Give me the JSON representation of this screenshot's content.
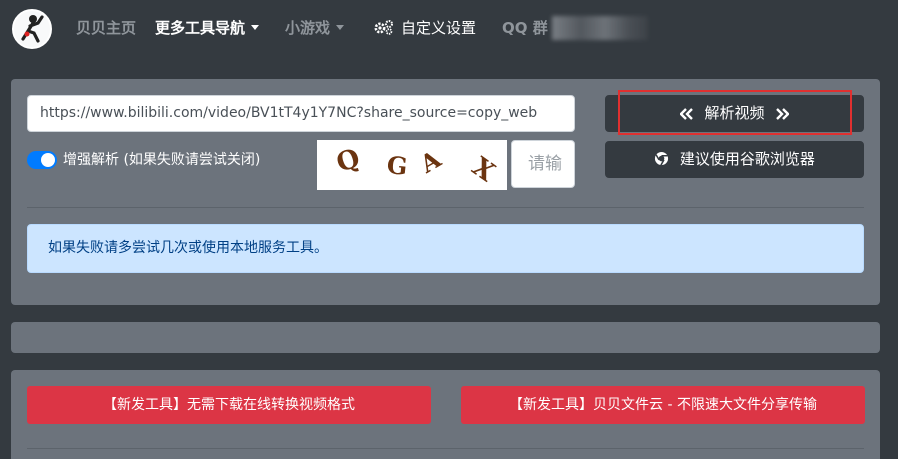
{
  "nav": {
    "home": "贝贝主页",
    "more_tools": "更多工具导航",
    "games": "小游戏",
    "custom_settings": "自定义设置",
    "qq_group": "QQ 群"
  },
  "parser": {
    "url_value": "https://www.bilibili.com/video/BV1tT4y1Y7NC?share_source=copy_web",
    "enhance_toggle_label": "增强解析 (如果失败请尝试关闭)",
    "enhance_enabled": true,
    "captcha_chars": [
      "Q",
      "G",
      "A",
      "X"
    ],
    "captcha_placeholder": "请输",
    "parse_button": "解析视频",
    "chrome_button": "建议使用谷歌浏览器",
    "alert_text": "如果失败请多尝试几次或使用本地服务工具。"
  },
  "promos": {
    "left": "【新发工具】无需下载在线转换视频格式",
    "right": "【新发工具】贝贝文件云 - 不限速大文件分享传输"
  },
  "colors": {
    "background": "#343a40",
    "panel": "#6c737c",
    "primary": "#007bff",
    "danger": "#dc3545",
    "alert_bg": "#cce5ff",
    "highlight": "#e03030"
  }
}
